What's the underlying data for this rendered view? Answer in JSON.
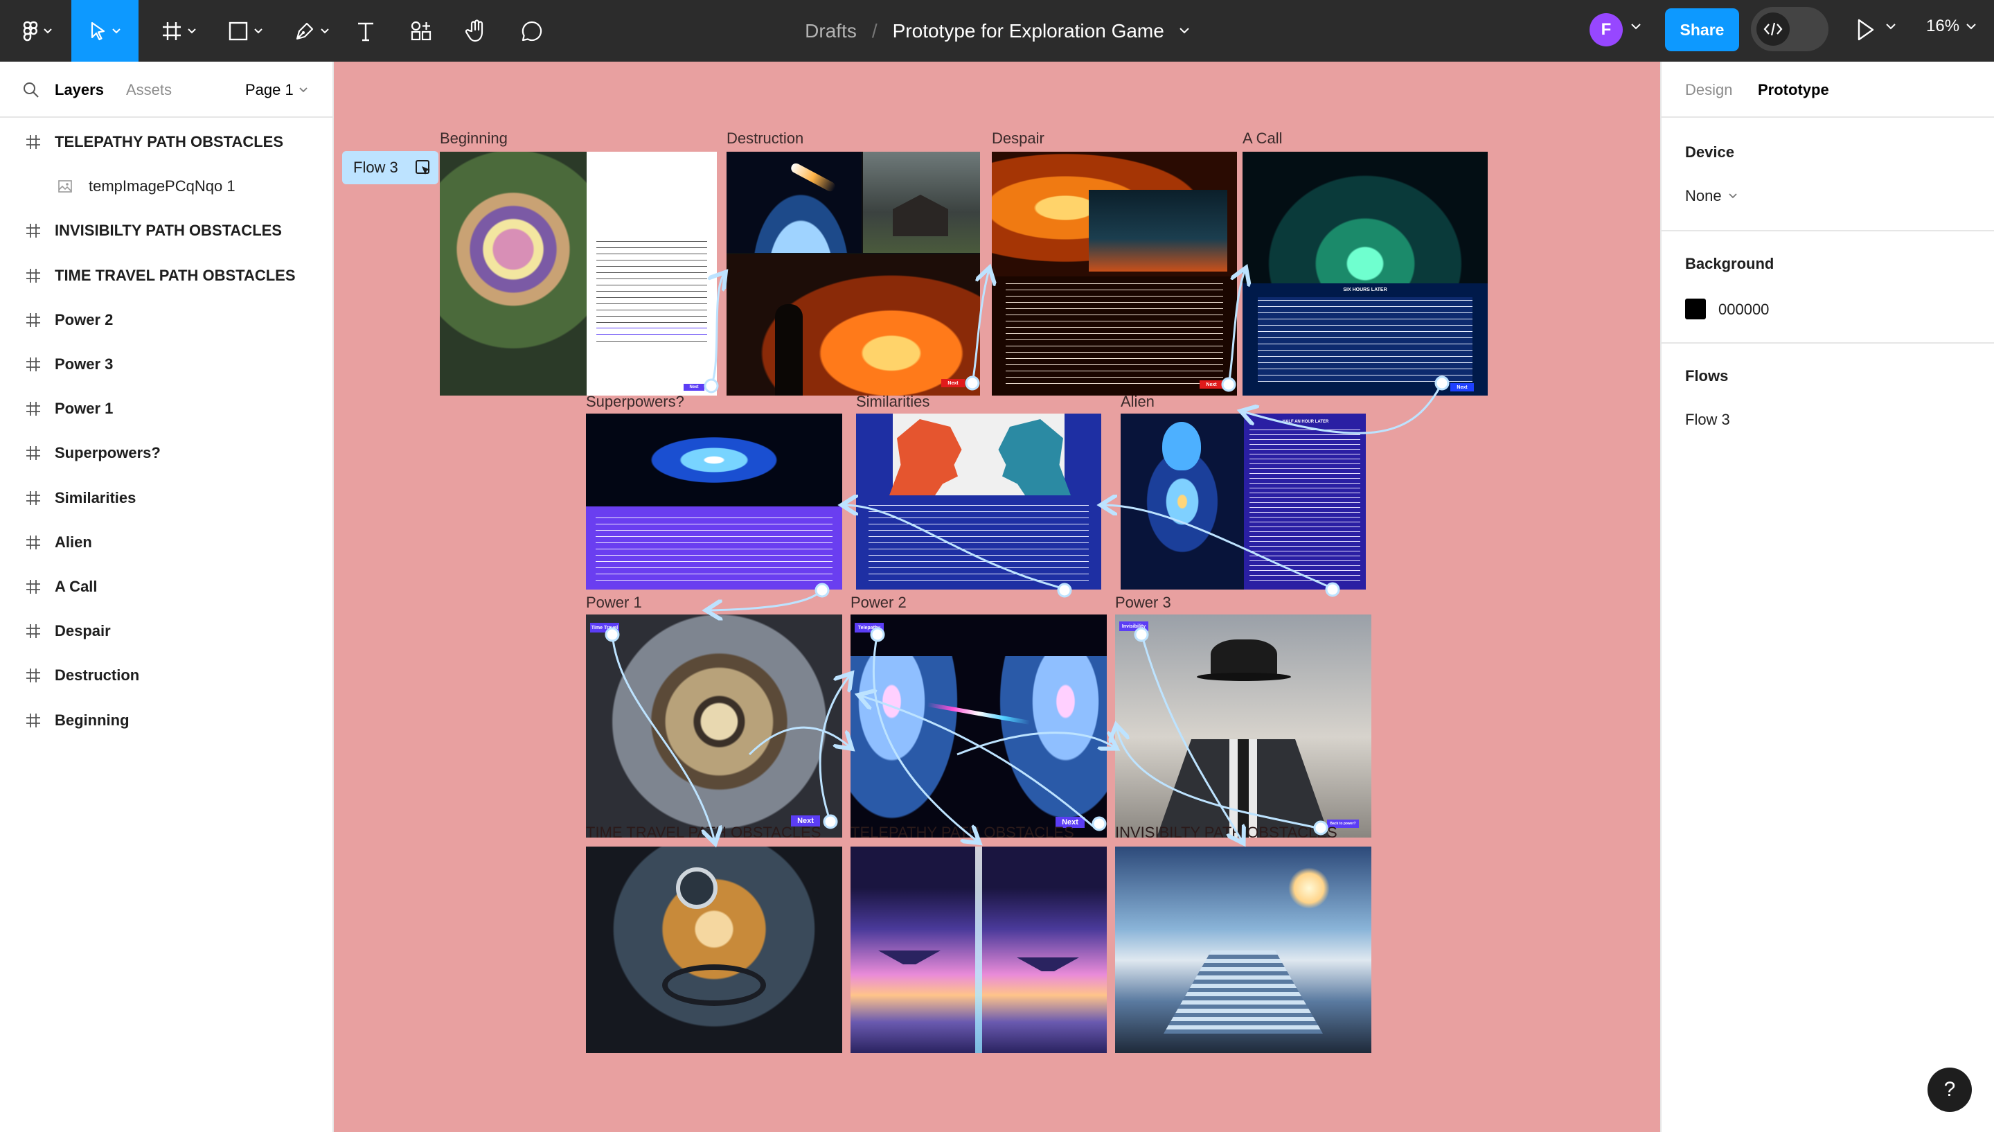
{
  "toolbar": {
    "breadcrumb_drafts": "Drafts",
    "breadcrumb_separator": "/",
    "file_title": "Prototype for Exploration Game",
    "avatar_initial": "F",
    "share_label": "Share",
    "zoom_level": "16%",
    "tools": [
      "main-menu-icon",
      "move-icon",
      "frame-icon",
      "shape-icon",
      "pen-icon",
      "text-icon",
      "resources-icon",
      "hand-icon",
      "comment-icon"
    ]
  },
  "left_panel": {
    "tab_layers": "Layers",
    "tab_assets": "Assets",
    "page_selector": "Page 1",
    "layers": [
      {
        "label": "TELEPATHY PATH OBSTACLES",
        "type": "frame"
      },
      {
        "label": "tempImagePCqNqo 1",
        "type": "image"
      },
      {
        "label": "INVISIBILTY PATH OBSTACLES",
        "type": "frame"
      },
      {
        "label": "TIME TRAVEL PATH OBSTACLES",
        "type": "frame"
      },
      {
        "label": "Power 2",
        "type": "frame"
      },
      {
        "label": "Power 3",
        "type": "frame"
      },
      {
        "label": "Power 1",
        "type": "frame"
      },
      {
        "label": "Superpowers?",
        "type": "frame"
      },
      {
        "label": "Similarities",
        "type": "frame"
      },
      {
        "label": "Alien",
        "type": "frame"
      },
      {
        "label": "A Call",
        "type": "frame"
      },
      {
        "label": "Despair",
        "type": "frame"
      },
      {
        "label": "Destruction",
        "type": "frame"
      },
      {
        "label": "Beginning",
        "type": "frame"
      }
    ]
  },
  "right_panel": {
    "tab_design": "Design",
    "tab_prototype": "Prototype",
    "device_heading": "Device",
    "device_value": "None",
    "background_heading": "Background",
    "background_value": "000000",
    "flows_heading": "Flows",
    "flow_item": "Flow 3"
  },
  "canvas": {
    "flow_badge": "Flow 3",
    "frames": {
      "beginning": {
        "label": "Beginning",
        "button": "Next"
      },
      "destruction": {
        "label": "Destruction",
        "button": "Next"
      },
      "despair": {
        "label": "Despair",
        "button": "Next"
      },
      "a_call": {
        "label": "A Call",
        "heading": "SIX HOURS LATER",
        "button": "Next"
      },
      "superpowers": {
        "label": "Superpowers?"
      },
      "similarities": {
        "label": "Similarities"
      },
      "alien": {
        "label": "Alien",
        "heading": "HALF AN HOUR LATER"
      },
      "power1": {
        "label": "Power 1",
        "tag": "Time Travel",
        "button": "Next"
      },
      "power2": {
        "label": "Power 2",
        "tag": "Telepathy",
        "button": "Next"
      },
      "power3": {
        "label": "Power 3",
        "tag": "Invisibility",
        "button": "Back to power?"
      },
      "time_travel": {
        "label": "TIME TRAVEL PATH OBSTACLES"
      },
      "telepathy": {
        "label": "TELEPATHY PATH OBSTACLES"
      },
      "invisibility": {
        "label": "INVISIBILTY PATH OBSTACLES"
      }
    }
  },
  "colors": {
    "canvas_bg": "#e8a0a0",
    "toolbar_bg": "#2c2c2c",
    "accent": "#0d99ff",
    "avatar": "#9747ff",
    "wire": "#bde3ff"
  }
}
